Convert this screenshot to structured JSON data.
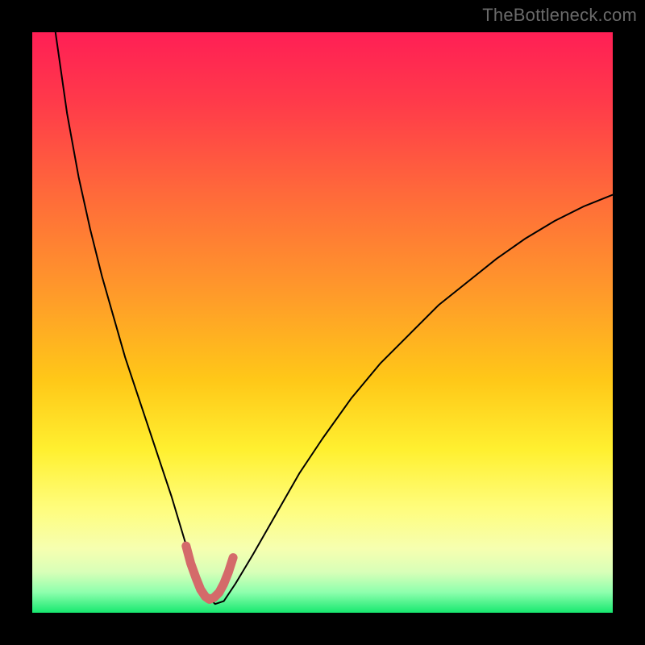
{
  "watermark": "TheBottleneck.com",
  "chart_data": {
    "type": "line",
    "title": "",
    "xlabel": "",
    "ylabel": "",
    "xlim": [
      0,
      100
    ],
    "ylim": [
      0,
      100
    ],
    "grid": false,
    "legend": false,
    "background_gradient_stops": [
      {
        "offset": 0.0,
        "color": "#ff1f55"
      },
      {
        "offset": 0.12,
        "color": "#ff3a4a"
      },
      {
        "offset": 0.28,
        "color": "#ff6a3a"
      },
      {
        "offset": 0.45,
        "color": "#ff9a2a"
      },
      {
        "offset": 0.6,
        "color": "#ffc818"
      },
      {
        "offset": 0.72,
        "color": "#fff030"
      },
      {
        "offset": 0.82,
        "color": "#fffd7d"
      },
      {
        "offset": 0.89,
        "color": "#f6ffb0"
      },
      {
        "offset": 0.93,
        "color": "#d8ffb8"
      },
      {
        "offset": 0.965,
        "color": "#8dffad"
      },
      {
        "offset": 1.0,
        "color": "#17e86f"
      }
    ],
    "series": [
      {
        "name": "bottleneck-curve",
        "stroke": "#000000",
        "stroke_width": 2,
        "x": [
          4,
          6,
          8,
          10,
          12,
          14,
          16,
          18,
          20,
          22,
          24,
          25.5,
          27,
          28.5,
          30,
          31.5,
          33,
          35,
          38,
          42,
          46,
          50,
          55,
          60,
          65,
          70,
          75,
          80,
          85,
          90,
          95,
          100
        ],
        "values": [
          100,
          86,
          75,
          66,
          58,
          51,
          44,
          38,
          32,
          26,
          20,
          15,
          10,
          6,
          3,
          1.5,
          2,
          5,
          10,
          17,
          24,
          30,
          37,
          43,
          48,
          53,
          57,
          61,
          64.5,
          67.5,
          70,
          72
        ]
      },
      {
        "name": "highlight-trough",
        "stroke": "#d46a6a",
        "stroke_width": 11,
        "x": [
          26.5,
          27.3,
          28.2,
          29.0,
          29.8,
          30.5,
          31.3,
          32.2,
          33.0,
          33.8,
          34.6
        ],
        "values": [
          11.5,
          8.5,
          6.0,
          4.0,
          2.8,
          2.3,
          2.6,
          3.5,
          5.0,
          7.0,
          9.5
        ]
      }
    ]
  }
}
